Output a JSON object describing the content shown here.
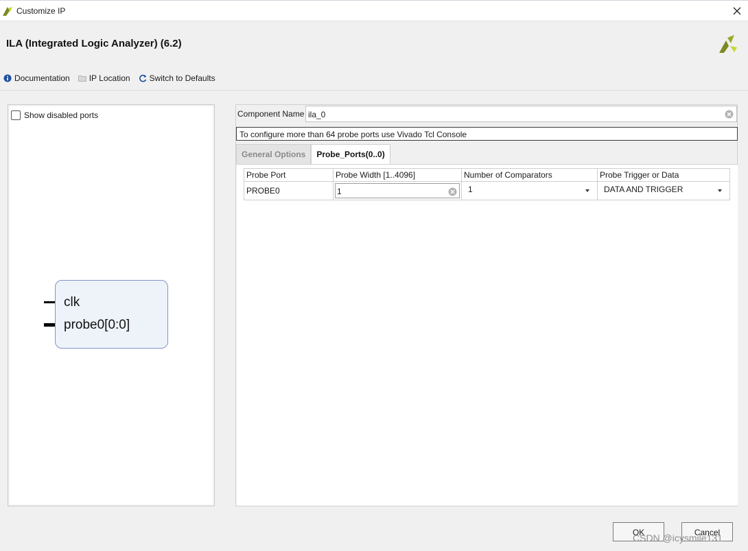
{
  "window": {
    "title": "Customize IP",
    "close_icon": "close-icon"
  },
  "header": {
    "ip_title": "ILA (Integrated Logic Analyzer) (6.2)",
    "brand_colors": {
      "logo_dark": "#7c8a23",
      "logo_light": "#c8d435"
    },
    "toolbar": {
      "documentation": "Documentation",
      "ip_location": "IP Location",
      "switch_defaults": "Switch to Defaults"
    }
  },
  "left_panel": {
    "show_disabled_ports": "Show disabled ports",
    "symbol": {
      "ports": [
        "clk",
        "probe0[0:0]"
      ]
    }
  },
  "right_panel": {
    "component_name_label": "Component Name",
    "component_name_value": "ila_0",
    "info": "To configure more than 64 probe ports use Vivado Tcl Console",
    "tabs": [
      "General Options",
      "Probe_Ports(0..0)"
    ],
    "active_tab": "Probe_Ports(0..0)",
    "table": {
      "headers": [
        "Probe Port",
        "Probe Width [1..4096]",
        "Number of Comparators",
        "Probe Trigger or Data"
      ],
      "rows": [
        {
          "port": "PROBE0",
          "width": "1",
          "comparators": "1",
          "trigger": "DATA AND TRIGGER"
        }
      ]
    }
  },
  "buttons": {
    "ok": "OK",
    "cancel": "Cancel"
  },
  "watermark": "CSDN @icysmile131"
}
